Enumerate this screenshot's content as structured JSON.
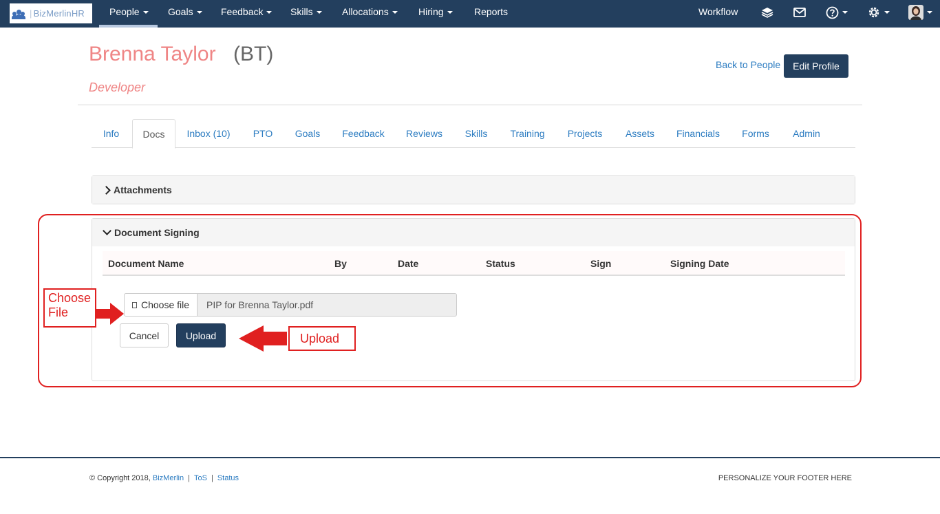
{
  "brand": {
    "logo_text": "BizMerlinHR",
    "logo_prefix": "BizMerlin",
    "logo_suffix": "HR"
  },
  "nav": {
    "items": [
      {
        "label": "People",
        "dropdown": true,
        "active": true
      },
      {
        "label": "Goals",
        "dropdown": true
      },
      {
        "label": "Feedback",
        "dropdown": true
      },
      {
        "label": "Skills",
        "dropdown": true
      },
      {
        "label": "Allocations",
        "dropdown": true
      },
      {
        "label": "Hiring",
        "dropdown": true
      },
      {
        "label": "Reports",
        "dropdown": false
      }
    ],
    "workflow_label": "Workflow",
    "icons": [
      "layers-icon",
      "mail-icon",
      "help-icon",
      "settings-icon",
      "user-avatar"
    ]
  },
  "profile": {
    "name": "Brenna Taylor",
    "initials": "(BT)",
    "role": "Developer",
    "back_link": "Back to People",
    "edit_button": "Edit Profile"
  },
  "tabs": [
    {
      "label": "Info"
    },
    {
      "label": "Docs",
      "active": true
    },
    {
      "label": "Inbox (10)"
    },
    {
      "label": "PTO"
    },
    {
      "label": "Goals"
    },
    {
      "label": "Feedback"
    },
    {
      "label": "Reviews"
    },
    {
      "label": "Skills"
    },
    {
      "label": "Training"
    },
    {
      "label": "Projects"
    },
    {
      "label": "Assets"
    },
    {
      "label": "Financials"
    },
    {
      "label": "Forms"
    },
    {
      "label": "Admin"
    }
  ],
  "attachments": {
    "title": "Attachments",
    "expanded": false
  },
  "document_signing": {
    "title": "Document Signing",
    "expanded": true,
    "columns": [
      "Document Name",
      "By",
      "Date",
      "Status",
      "Sign",
      "Signing Date"
    ],
    "choose_file_label": "Choose file",
    "selected_file": "PIP for Brenna Taylor.pdf",
    "cancel_label": "Cancel",
    "upload_label": "Upload"
  },
  "annotations": {
    "choose_file_line1": "Choose",
    "choose_file_line2": "File",
    "upload": "Upload",
    "color": "#e02020"
  },
  "footer": {
    "copyright": "© Copyright 2018,",
    "brand_link": "BizMerlin",
    "tos": "ToS",
    "status": "Status",
    "right_text": "PERSONALIZE YOUR FOOTER HERE"
  },
  "colors": {
    "navbar": "#233f5e",
    "accent_name": "#ef8585",
    "link": "#2c7cc1"
  }
}
